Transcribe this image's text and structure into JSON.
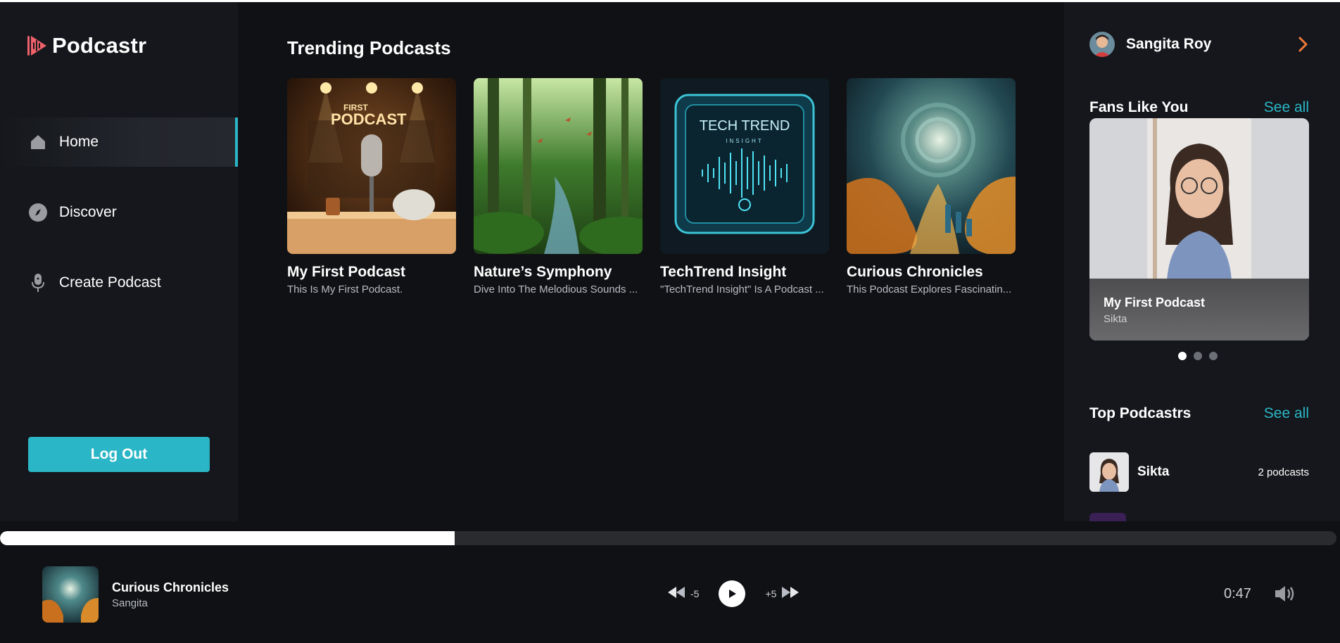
{
  "app": {
    "name": "Podcastr"
  },
  "nav": [
    {
      "label": "Home",
      "icon": "home-icon"
    },
    {
      "label": "Discover",
      "icon": "compass-icon"
    },
    {
      "label": "Create Podcast",
      "icon": "microphone-icon"
    }
  ],
  "logout_label": "Log Out",
  "main": {
    "title": "Trending Podcasts",
    "cards": [
      {
        "title": "My First Podcast",
        "desc": "This Is My First Podcast.",
        "art_text_1": "FIRST",
        "art_text_2": "PODCAST"
      },
      {
        "title": "Nature’s Symphony",
        "desc": "Dive Into The Melodious Sounds ..."
      },
      {
        "title": "TechTrend Insight",
        "desc": "\"TechTrend Insight\" Is A Podcast ...",
        "art_text_1": "TECH TREND",
        "art_text_2": "INSIGHT"
      },
      {
        "title": "Curious Chronicles",
        "desc": "This Podcast Explores Fascinatin..."
      }
    ]
  },
  "right": {
    "user_name": "Sangita Roy",
    "fans": {
      "title": "Fans Like You",
      "see_all": "See all",
      "card_title": "My First Podcast",
      "card_sub": "Sikta",
      "slide_count": 3,
      "active_slide": 1
    },
    "top": {
      "title": "Top Podcastrs",
      "see_all": "See all",
      "items": [
        {
          "name": "Sikta",
          "count": "2 podcasts"
        }
      ]
    }
  },
  "player": {
    "progress": 0.34,
    "title": "Curious Chronicles",
    "artist": "Sangita",
    "rewind": "-5",
    "forward": "+5",
    "time": "0:47"
  },
  "colors": {
    "accent": "#2ab6c6",
    "logo": "#f0616b",
    "chevron": "#f07a3a",
    "sidebar": "#15171c",
    "background": "#101114"
  }
}
